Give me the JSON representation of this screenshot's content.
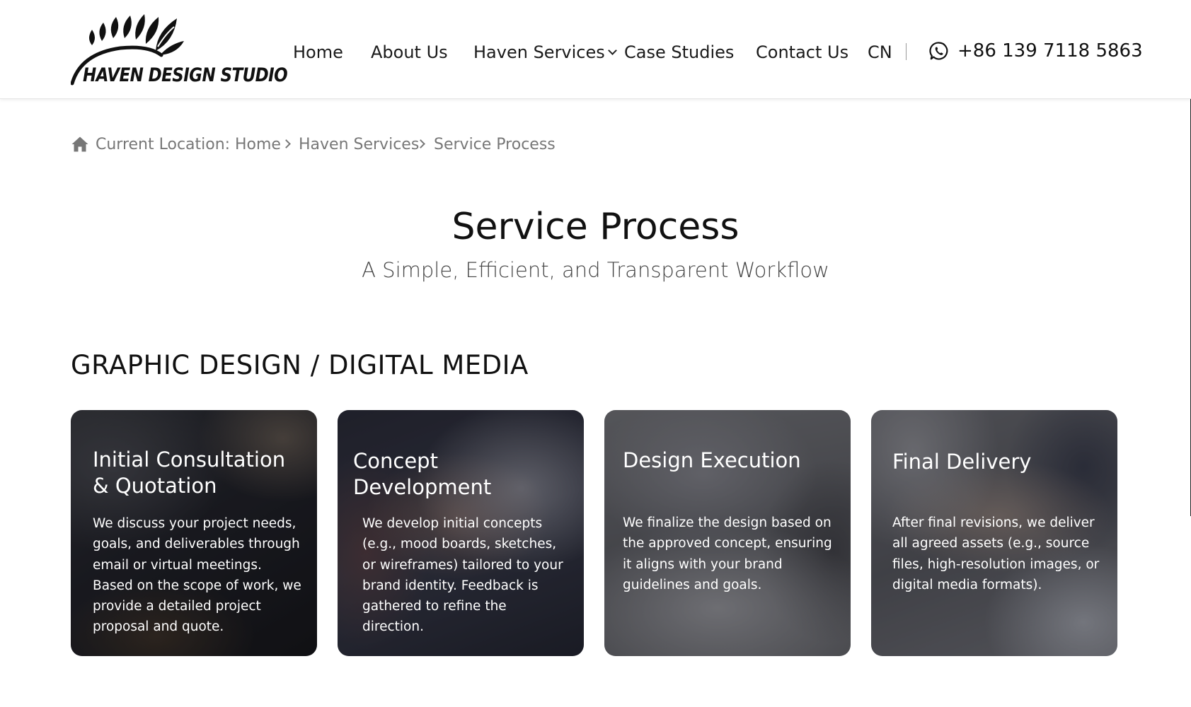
{
  "header": {
    "logo_text": "HAVEN DESIGN STUDIO",
    "nav": {
      "home": "Home",
      "about": "About Us",
      "services": "Haven Services",
      "cases": "Case Studies",
      "contact": "Contact Us",
      "language": "CN"
    },
    "phone": "+86 139 7118 5863",
    "phone_icon": "whatsapp-icon"
  },
  "breadcrumb": {
    "icon": "home-icon",
    "prefix": "Current Location:",
    "items": [
      "Home",
      "Haven Services",
      "Service Process"
    ]
  },
  "main": {
    "title": "Service Process",
    "subtitle": "A Simple, Efficient, and Transparent Workflow",
    "section_title": "GRAPHIC DESIGN / DIGITAL MEDIA",
    "cards": [
      {
        "title": "Initial Consultation & Quotation",
        "description": "We discuss your project needs, goals, and deliverables through email or virtual meetings. Based on the scope of work, we provide a detailed project proposal and quote."
      },
      {
        "title": "Concept Development",
        "description": "We develop initial concepts (e.g., mood boards, sketches, or wireframes) tailored to your brand identity. Feedback is gathered to refine the direction."
      },
      {
        "title": "Design Execution",
        "description": "We finalize the design based on the approved concept, ensuring it aligns with your brand guidelines and goals."
      },
      {
        "title": "Final Delivery",
        "description": "After final revisions, we deliver all agreed assets (e.g., source files, high-resolution images, or digital media formats)."
      }
    ]
  },
  "colors": {
    "text": "#111111",
    "muted": "#777777",
    "header_bg": "#ffffff"
  }
}
